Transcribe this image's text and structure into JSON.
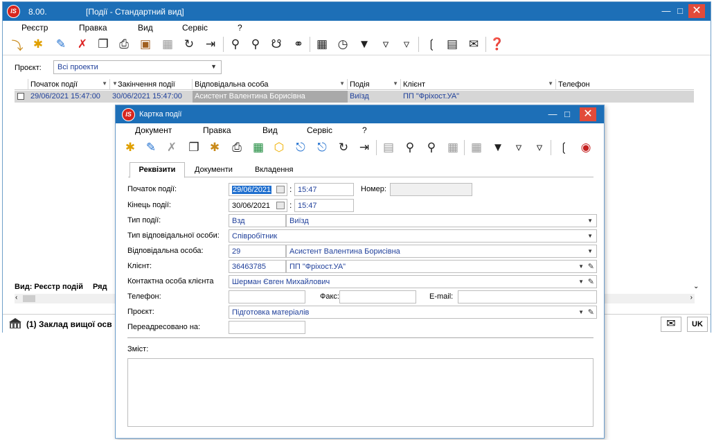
{
  "main": {
    "version": "8.00.",
    "title": "[Події - Стандартний вид]",
    "menu": [
      "Реєстр",
      "Правка",
      "Вид",
      "Сервіс",
      "?"
    ],
    "project_label": "Проєкт:",
    "project_value": "Всі проекти",
    "columns": [
      "Початок події",
      "Закінчення події",
      "Відповідальна особа",
      "Подія",
      "Клієнт",
      "Телефон"
    ],
    "rows": [
      {
        "start": "29/06/2021 15:47:00",
        "end": "30/06/2021 15:47:00",
        "responsible": "Асистент Валентина Борисівна",
        "event": "Виїзд",
        "client": "ПП \"Фріхост.УА\"",
        "phone": ""
      }
    ],
    "view_footer": {
      "view": "Вид: Реєстр подій",
      "rows": "Ряд"
    },
    "status_text": "(1) Заклад вищої осв",
    "lang": "UK"
  },
  "dialog": {
    "title": "Картка події",
    "menu": [
      "Документ",
      "Правка",
      "Вид",
      "Сервіс",
      "?"
    ],
    "tabs": [
      "Реквізити",
      "Документи",
      "Вкладення"
    ],
    "labels": {
      "start": "Початок події:",
      "end": "Кінець події:",
      "number": "Номер:",
      "event_type": "Тип події:",
      "resp_type": "Тип відповідальної особи:",
      "responsible": "Відповідальна особа:",
      "client": "Клієнт:",
      "contact": "Контактна особа клієнта",
      "phone": "Телефон:",
      "fax": "Факс:",
      "email": "E-mail:",
      "project": "Проєкт:",
      "redirected": "Переадресовано на:",
      "content": "Зміст:"
    },
    "values": {
      "start_date": "29/06/2021",
      "start_time": "15:47",
      "end_date": "30/06/2021",
      "end_time": "15:47",
      "number": "",
      "event_code": "Взд",
      "event_name": "Виїзд",
      "resp_type": "Співробітник",
      "resp_code": "29",
      "resp_name": "Асистент Валентина Борисівна",
      "client_code": "36463785",
      "client_name": "ПП \"Фріхост.УА\"",
      "contact": "Шерман Євген Михайлович",
      "phone": "",
      "fax": "",
      "email": "",
      "project": "Підготовка матеріалів",
      "redirected": "",
      "content": ""
    }
  },
  "colors": {
    "titlebar": "#1d6fb7",
    "close_button": "#e24b3a",
    "value_text": "#1f3f9a",
    "selected_row": "#d6d6d6"
  }
}
